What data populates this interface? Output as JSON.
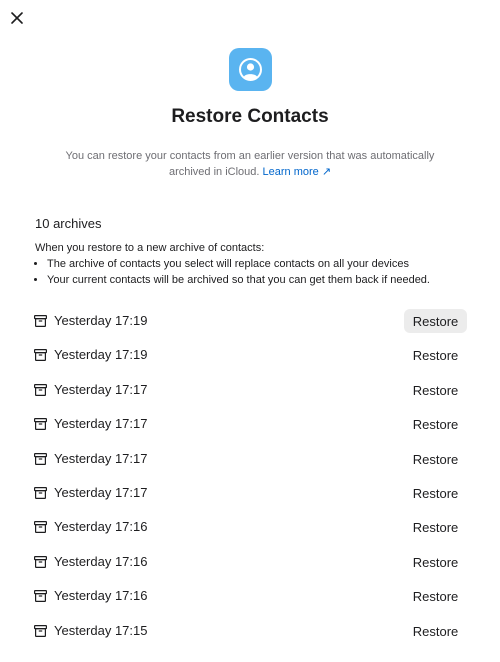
{
  "dialog": {
    "close_label": "close",
    "title": "Restore Contacts",
    "description": "You can restore your contacts from an earlier version that was automatically archived in iCloud.",
    "learn_more": "Learn more ↗"
  },
  "archives": {
    "count_text": "10 archives",
    "info_heading": "When you restore to a new archive of contacts:",
    "bullets": [
      "The archive of contacts you select will replace contacts on all your devices",
      "Your current contacts will be archived so that you can get them back if needed."
    ],
    "restore_label": "Restore",
    "items": [
      {
        "time": "Yesterday 17:19"
      },
      {
        "time": "Yesterday 17:19"
      },
      {
        "time": "Yesterday 17:17"
      },
      {
        "time": "Yesterday 17:17"
      },
      {
        "time": "Yesterday 17:17"
      },
      {
        "time": "Yesterday 17:17"
      },
      {
        "time": "Yesterday 17:16"
      },
      {
        "time": "Yesterday 17:16"
      },
      {
        "time": "Yesterday 17:16"
      },
      {
        "time": "Yesterday 17:15"
      }
    ]
  },
  "colors": {
    "accent": "#0066cc",
    "icon_bg": "#5ab4f0",
    "hover_bg": "#ececec"
  },
  "icons": {
    "close": "close-icon",
    "app": "contacts-person-icon",
    "archive": "archive-box-icon"
  }
}
